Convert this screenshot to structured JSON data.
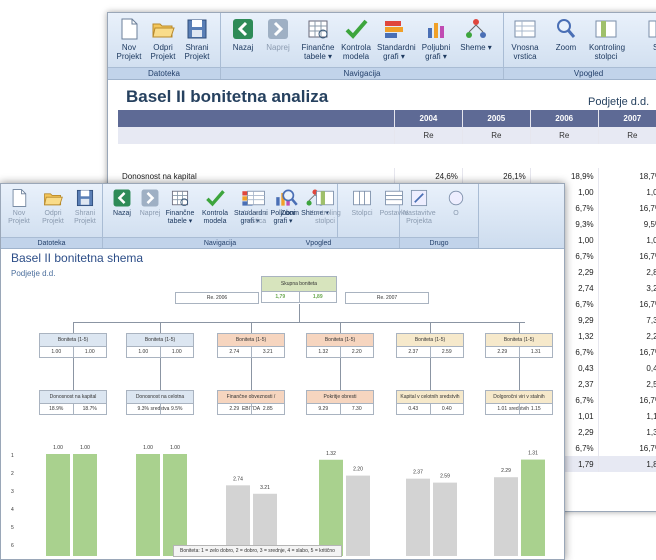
{
  "back": {
    "ribbon": {
      "groups": [
        {
          "caption": "Datoteka",
          "buttons": [
            {
              "label": "Nov Projekt",
              "icon": "new-file-icon"
            },
            {
              "label": "Odpri Projekt",
              "icon": "open-folder-icon"
            },
            {
              "label": "Shrani Projekt",
              "icon": "save-icon"
            }
          ]
        },
        {
          "caption": "Navigacija",
          "buttons": [
            {
              "label": "Nazaj",
              "icon": "back-arrow-icon"
            },
            {
              "label": "Naprej",
              "icon": "forward-arrow-icon",
              "disabled": true
            },
            {
              "label": "Finančne tabele ▾",
              "icon": "table-icon"
            },
            {
              "label": "Kontrola modela",
              "icon": "checkmark-icon"
            },
            {
              "label": "Standardni grafi ▾",
              "icon": "bar-chart-icon"
            },
            {
              "label": "Poljubni grafi ▾",
              "icon": "custom-chart-icon"
            },
            {
              "label": "Sheme ▾",
              "icon": "schema-icon"
            }
          ]
        },
        {
          "caption": "Vpogled",
          "buttons": [
            {
              "label": "Vnosna vrstica",
              "icon": "input-row-icon"
            },
            {
              "label": "Zoom",
              "icon": "zoom-icon"
            },
            {
              "label": "Kontroling stolpci",
              "icon": "columns-icon"
            },
            {
              "label": "Sto",
              "icon": "columns2-icon"
            }
          ]
        }
      ]
    },
    "title": "Basel II bonitetna analiza",
    "company": "Podjetje d.d.",
    "years": [
      "2004",
      "2005",
      "2006",
      "2007"
    ],
    "types": [
      "Re",
      "Re",
      "Re",
      "Re"
    ],
    "rows": [
      {
        "label": "Donosnost na kapital",
        "values": [
          "24,6%",
          "26,1%",
          "18,9%",
          "18,7%"
        ]
      },
      {
        "label": "",
        "values": [
          "",
          "",
          "1,00",
          "1,00"
        ]
      },
      {
        "label": "",
        "values": [
          "",
          "",
          "6,7%",
          "16,7%"
        ]
      },
      {
        "label": "",
        "values": [
          "",
          "",
          "9,3%",
          "9,5%"
        ]
      },
      {
        "label": "",
        "values": [
          "",
          "",
          "1,00",
          "1,00"
        ]
      },
      {
        "label": "",
        "values": [
          "",
          "",
          "6,7%",
          "16,7%"
        ]
      },
      {
        "label": "",
        "values": [
          "",
          "",
          "2,29",
          "2,85"
        ]
      },
      {
        "label": "",
        "values": [
          "",
          "",
          "2,74",
          "3,21"
        ]
      },
      {
        "label": "",
        "values": [
          "",
          "",
          "6,7%",
          "16,7%"
        ]
      },
      {
        "label": "",
        "values": [
          "",
          "",
          "9,29",
          "7,30"
        ]
      },
      {
        "label": "",
        "values": [
          "",
          "",
          "1,32",
          "2,20"
        ]
      },
      {
        "label": "",
        "values": [
          "",
          "",
          "6,7%",
          "16,7%"
        ]
      },
      {
        "label": "",
        "values": [
          "",
          "",
          "0,43",
          "0,40"
        ]
      },
      {
        "label": "",
        "values": [
          "",
          "",
          "2,37",
          "2,59"
        ]
      },
      {
        "label": "",
        "values": [
          "",
          "",
          "6,7%",
          "16,7%"
        ]
      },
      {
        "label": "",
        "values": [
          "",
          "",
          "1,01",
          "1,15"
        ]
      },
      {
        "label": "",
        "values": [
          "",
          "",
          "2,29",
          "1,31"
        ]
      },
      {
        "label": "",
        "values": [
          "",
          "",
          "6,7%",
          "16,7%"
        ]
      },
      {
        "label": "",
        "values": [
          "",
          "",
          "1,79",
          "1,89"
        ]
      }
    ]
  },
  "front": {
    "ribbon": {
      "groups": [
        {
          "caption": "Datoteka",
          "buttons": [
            {
              "label": "Nov Projekt",
              "icon": "new-file-icon",
              "disabled": true
            },
            {
              "label": "Odpri Projekt",
              "icon": "open-folder-icon",
              "disabled": true
            },
            {
              "label": "Shrani Projekt",
              "icon": "save-icon",
              "disabled": true
            }
          ]
        },
        {
          "caption": "Navigacija",
          "buttons": [
            {
              "label": "Nazaj",
              "icon": "back-arrow-icon"
            },
            {
              "label": "Naprej",
              "icon": "forward-arrow-icon",
              "disabled": true
            },
            {
              "label": "Finančne tabele ▾",
              "icon": "table-icon"
            },
            {
              "label": "Kontrola modela",
              "icon": "checkmark-icon"
            },
            {
              "label": "Standardni grafi ▾",
              "icon": "bar-chart-icon"
            },
            {
              "label": "Poljubni grafi ▾",
              "icon": "custom-chart-icon"
            },
            {
              "label": "Sheme ▾",
              "icon": "schema-icon"
            }
          ]
        },
        {
          "caption": "Vpogled",
          "buttons": [
            {
              "label": "Vnosna vrstica",
              "icon": "input-row-icon",
              "disabled": true
            },
            {
              "label": "Zoom",
              "icon": "zoom-icon"
            },
            {
              "label": "Kontroling stolpci",
              "icon": "columns-icon",
              "disabled": true
            },
            {
              "label": "Stolpci",
              "icon": "columns2-icon",
              "disabled": true
            },
            {
              "label": "Postavke",
              "icon": "items-icon",
              "disabled": true
            }
          ]
        },
        {
          "caption": "Drugo",
          "buttons": [
            {
              "label": "Nastavitve Projekta",
              "icon": "settings-icon",
              "disabled": true
            },
            {
              "label": "O",
              "icon": "info-icon",
              "disabled": true
            }
          ]
        }
      ]
    },
    "title": "Basel II bonitetna shema",
    "company": "Podjetje d.d.",
    "top_box": {
      "title": "Skupna boniteta",
      "v1": "1,79",
      "v2": "1,89",
      "left_label": "Re. 2006",
      "right_label": "Re. 2007"
    },
    "rating_boxes": [
      {
        "title": "Boniteta (1-5)",
        "v1": "1.00",
        "v2": "1.00",
        "color": "bl"
      },
      {
        "title": "Boniteta (1-5)",
        "v1": "1.00",
        "v2": "1.00",
        "color": "bl"
      },
      {
        "title": "Boniteta (1-5)",
        "v1": "2.74",
        "v2": "3.21",
        "color": "or"
      },
      {
        "title": "Boniteta (1-5)",
        "v1": "1.32",
        "v2": "2.20",
        "color": "or"
      },
      {
        "title": "Boniteta (1-5)",
        "v1": "2.37",
        "v2": "2.59",
        "color": "ye"
      },
      {
        "title": "Boniteta (1-5)",
        "v1": "2.29",
        "v2": "1.31",
        "color": "ye"
      }
    ],
    "indicator_boxes": [
      {
        "title": "Donosnost na kapital",
        "v1": "18.9%",
        "v2": "18.7%",
        "color": "bl"
      },
      {
        "title": "Donosnost na celotna sredstva",
        "v1": "9.3%",
        "v2": "9.5%",
        "color": "bl"
      },
      {
        "title": "Finančne obveznosti / EBITDA",
        "v1": "2.29",
        "v2": "2.85",
        "color": "or"
      },
      {
        "title": "Pokritje obresti",
        "v1": "9.29",
        "v2": "7.30",
        "color": "or"
      },
      {
        "title": "Kapital v celotnih sredstvih",
        "v1": "0.43",
        "v2": "0.40",
        "color": "ye"
      },
      {
        "title": "Dolgoročni viri v stalnih sredstvih",
        "v1": "1.01",
        "v2": "1.15",
        "color": "ye"
      }
    ],
    "legend": "Boniteta: 1 = zelo dobro, 2 = dobro, 3 = srednje, 4 = slabo, 5 = kritično",
    "chart_data": {
      "type": "bar",
      "categories": [
        "1",
        "2",
        "3",
        "4",
        "5",
        "6"
      ],
      "series": [
        {
          "values": [
            1.0,
            1.0,
            2.74,
            1.32,
            2.37,
            2.29
          ]
        },
        {
          "values": [
            1.0,
            1.0,
            3.21,
            2.2,
            2.59,
            1.31
          ]
        }
      ],
      "value_labels": [
        [
          "1.00",
          "1.00"
        ],
        [
          "1.00",
          "1.00"
        ],
        [
          "2.74",
          "3.21"
        ],
        [
          "1.32",
          "2.20"
        ],
        [
          "2.37",
          "2.59"
        ],
        [
          "2.29",
          "1.31"
        ]
      ],
      "bar_colors": {
        "good": "#a9d18e",
        "weak": "#d3d3d3"
      },
      "y_ticks": [
        "1",
        "2",
        "3",
        "4",
        "5",
        "6"
      ],
      "ylim": [
        1,
        6
      ],
      "y_inverted": true
    }
  }
}
